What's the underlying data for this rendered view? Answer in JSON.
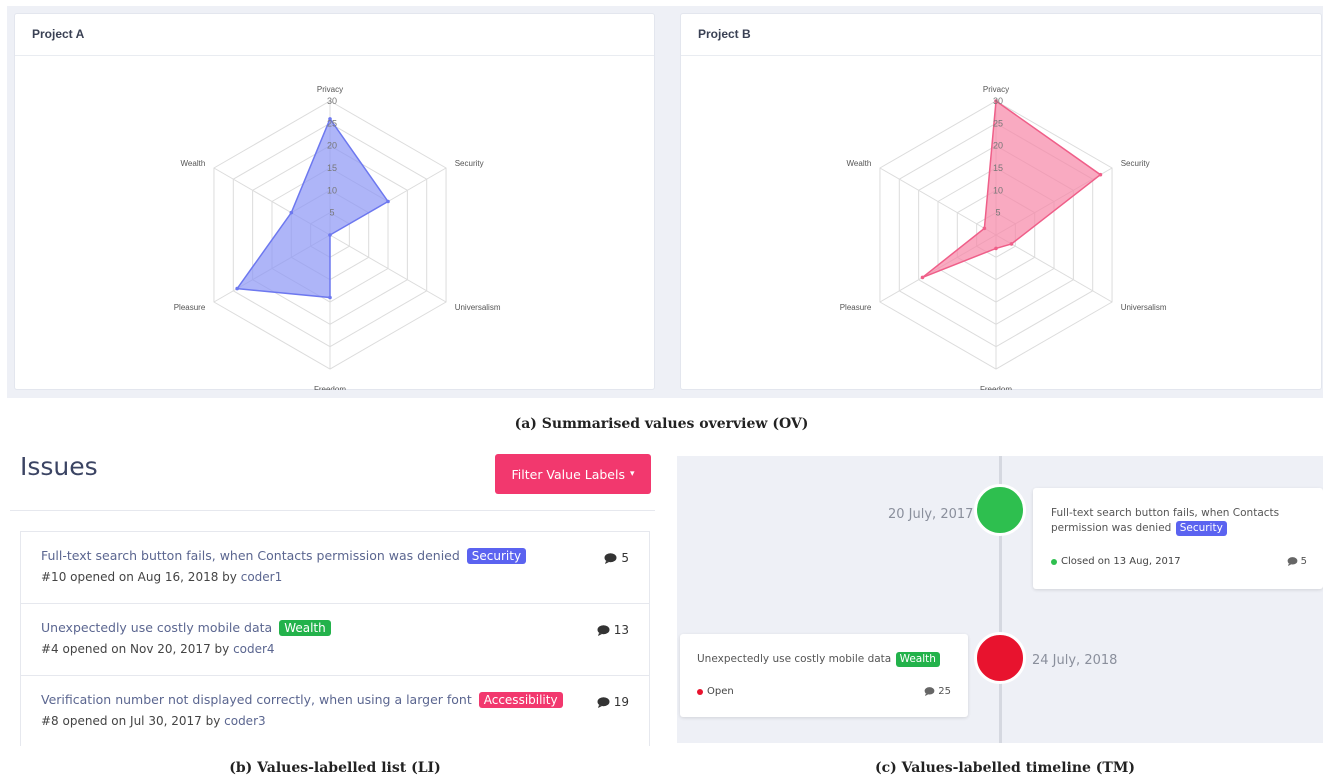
{
  "colors": {
    "project_a_fill": "#8c96f5",
    "project_a_stroke": "#6d78ef",
    "project_b_fill": "#f786a6",
    "project_b_stroke": "#ef5f89",
    "security_badge": "#5b63f0",
    "wealth_badge": "#23b24b",
    "accessibility_badge": "#f2386e",
    "closed_dot": "#2ebf4f",
    "open_dot": "#e8132e",
    "filter_button": "#f2386e"
  },
  "overview": {
    "caption": "(a) Summarised values overview (OV)",
    "project_a": {
      "title": "Project A"
    },
    "project_b": {
      "title": "Project B"
    }
  },
  "chart_data": [
    {
      "type": "radar",
      "title": "Project A",
      "axes": [
        "Privacy",
        "Security",
        "Universalism",
        "Freedom",
        "Pleasure",
        "Wealth"
      ],
      "ticks": [
        "5",
        "10",
        "15",
        "20",
        "25",
        "30"
      ],
      "rlim": [
        0,
        30
      ],
      "values": [
        26,
        15,
        0,
        14,
        24,
        10
      ]
    },
    {
      "type": "radar",
      "title": "Project B",
      "axes": [
        "Privacy",
        "Security",
        "Universalism",
        "Freedom",
        "Pleasure",
        "Wealth"
      ],
      "ticks": [
        "5",
        "10",
        "15",
        "20",
        "25",
        "30"
      ],
      "rlim": [
        0,
        30
      ],
      "values": [
        30,
        27,
        4,
        3,
        19,
        3
      ]
    }
  ],
  "issues": {
    "title": "Issues",
    "filter_label": "Filter Value Labels",
    "caption": "(b) Values-labelled list (LI)",
    "items": [
      {
        "title": "Full-text search button fails, when Contacts permission was denied",
        "label": "Security",
        "meta_prefix": "#10 opened on Aug 16, 2018 by",
        "user": "coder1",
        "comments": "5"
      },
      {
        "title": "Unexpectedly use costly mobile data",
        "label": "Wealth",
        "meta_prefix": "#4 opened on Nov 20, 2017 by",
        "user": "coder4",
        "comments": "13"
      },
      {
        "title": "Verification number not displayed correctly, when using a larger font",
        "label": "Accessibility",
        "meta_prefix": "#8 opened on Jul 30, 2017 by",
        "user": "coder3",
        "comments": "19"
      }
    ]
  },
  "timeline": {
    "caption": "(c) Values-labelled timeline (TM)",
    "events": [
      {
        "date": "20 July, 2017",
        "text_line1": "Full-text search button fails, when Contacts",
        "text_line2": "permission was denied",
        "label": "Security",
        "status": "Closed on 13 Aug, 2017",
        "comments": "5"
      },
      {
        "date": "24 July, 2018",
        "text": "Unexpectedly use costly mobile data",
        "label": "Wealth",
        "status": "Open",
        "comments": "25"
      }
    ]
  }
}
